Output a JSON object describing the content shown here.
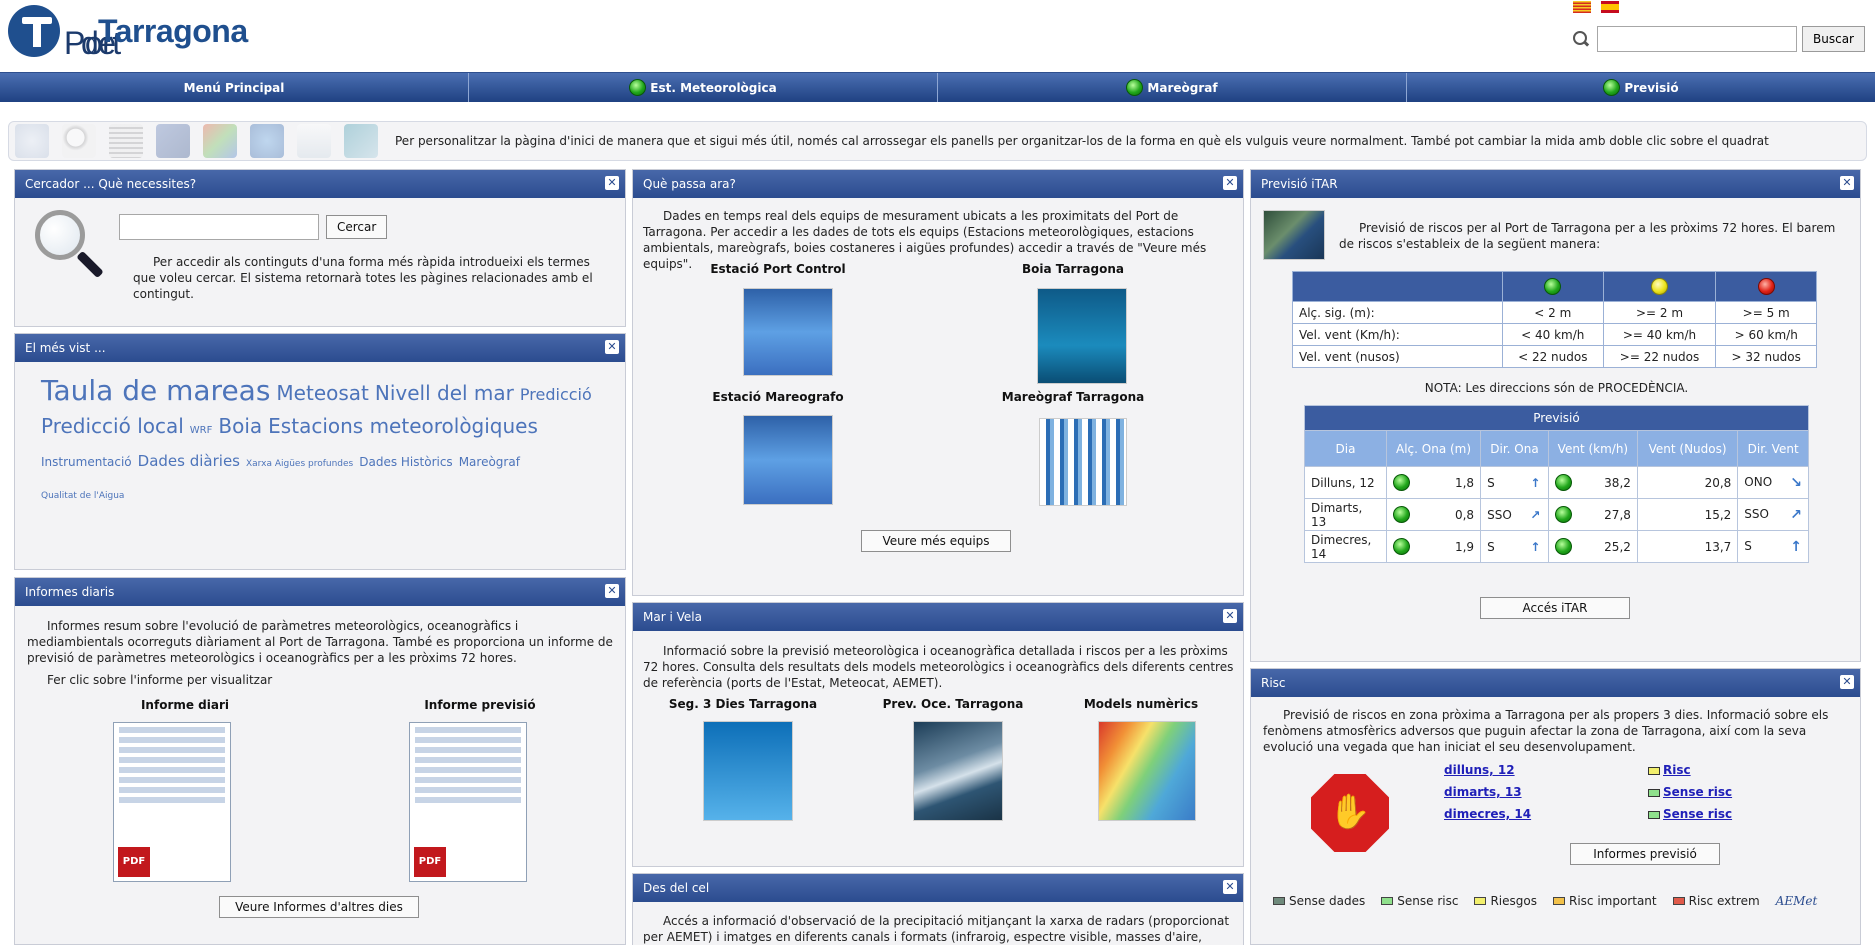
{
  "header": {
    "logo_light": "Port ",
    "logo_mid": "de ",
    "logo_bold": "Tarragona",
    "search_button": "Buscar"
  },
  "nav": [
    {
      "label": "Menú Principal",
      "light": false
    },
    {
      "label": "Est. Meteorològica",
      "light": true
    },
    {
      "label": "Mareògraf",
      "light": true
    },
    {
      "label": "Previsió",
      "light": true
    }
  ],
  "strip": {
    "text": "Per personalitzar la pàgina d'inici de manera que et sigui més útil, només cal arrossegar els panells per organitzar-los de la forma en què els vulguis veure normalment. També pot cambiar la mida amb doble clic sobre el quadrat"
  },
  "cercador": {
    "title": "Cercador ... Què necessites?",
    "button": "Cercar",
    "text": "Per accedir als continguts d'una forma més ràpida introdueixi els termes que voleu cercar. El sistema retornarà totes les pàgines relacionades amb el contingut."
  },
  "mesvist": {
    "title": "El més vist ...",
    "tags": [
      {
        "text": "Taula de mareas",
        "size": 28
      },
      {
        "text": "Meteosat",
        "size": 20
      },
      {
        "text": "Nivell del mar",
        "size": 20
      },
      {
        "text": "Predicció",
        "size": 16
      },
      {
        "text": "Predicció local",
        "size": 20
      },
      {
        "text": "WRF",
        "size": 10
      },
      {
        "text": "Boia",
        "size": 20
      },
      {
        "text": "Estacions meteorològiques",
        "size": 20
      },
      {
        "text": "Instrumentació",
        "size": 12
      },
      {
        "text": "Dades diàries",
        "size": 15
      },
      {
        "text": "Xarxa Aigües profundes",
        "size": 9
      },
      {
        "text": "Dades Històrics",
        "size": 12
      },
      {
        "text": "Mareògraf",
        "size": 12
      },
      {
        "text": "Qualitat de l'Aigua",
        "size": 9
      }
    ]
  },
  "informes": {
    "title": "Informes diaris",
    "text": "Informes resum sobre l'evolució de paràmetres meteorològics, oceanogràfics i mediambientals ocorreguts diàriament al Port de Tarragona. També es proporciona un informe de previsió de paràmetres meteorològics i oceanogràfics per a les pròxims 72 hores.",
    "click": "Fer clic sobre l'informe per visualitzar",
    "items": [
      "Informe diari",
      "Informe previsió"
    ],
    "button": "Veure Informes d'altres dies"
  },
  "quepassa": {
    "title": "Què passa ara?",
    "text": "Dades en temps real dels equips de mesurament ubicats a les proximitats del Port de Tarragona. Per accedir a les dades de tots els equips (Estacions meteorològiques, estacions ambientals, mareògrafs, boies costaneres i aigües profundes) accedir a través de \"Veure més equips\".",
    "items": [
      "Estació Port Control",
      "Boia Tarragona",
      "Estació Mareografo",
      "Mareògraf Tarragona"
    ],
    "button": "Veure més equips"
  },
  "marvela": {
    "title": "Mar i Vela",
    "text": "Informació sobre la previsió meteorològica i oceanogràfica detallada i riscos per a les pròxims 72 hores. Consulta dels resultats dels models meteorològics i oceanogràfics dels diferents centres de referència (ports de l'Estat, Meteocat, AEMET).",
    "items": [
      "Seg. 3 Dies Tarragona",
      "Prev. Oce. Tarragona",
      "Models numèrics"
    ]
  },
  "descel": {
    "title": "Des del cel",
    "text": "Accés a informació d'observació de la precipitació mitjançant la xarxa de radars (proporcionat per AEMET) i imatges en diferents canals i formats (infraroig, espectre visible, masses d'aire, vapor d'aigua) del"
  },
  "itar": {
    "title": "Previsió iTAR",
    "text": "Previsió de riscos per al Port de Tarragona per a les pròxims 72 hores. El barem de riscos s'estableix de la següent manera:",
    "risk_rows": [
      {
        "label": "Alç. sig. (m):",
        "g": "< 2 m",
        "y": ">= 2 m",
        "r": ">= 5 m"
      },
      {
        "label": "Vel. vent (Km/h):",
        "g": "< 40 km/h",
        "y": ">= 40 km/h",
        "r": "> 60 km/h"
      },
      {
        "label": "Vel. vent (nusos)",
        "g": "< 22 nudos",
        "y": ">= 22 nudos",
        "r": "> 32 nudos"
      }
    ],
    "note": "NOTA: Les direccions són de PROCEDÈNCIA.",
    "forecast_title": "Previsió",
    "forecast_headers": [
      "Dia",
      "Alç. Ona (m)",
      "Dir. Ona",
      "Vent (km/h)",
      "Vent (Nudos)",
      "Dir. Vent"
    ],
    "forecast_rows": [
      {
        "dia": "Dilluns, 12",
        "ona": "1,8",
        "dir_ona": "S",
        "arrow_ona": "↑",
        "vent": "38,2",
        "nudos": "20,8",
        "dir_vent": "ONO",
        "arrow_vent": "↘"
      },
      {
        "dia": "Dimarts, 13",
        "ona": "0,8",
        "dir_ona": "SSO",
        "arrow_ona": "↗",
        "vent": "27,8",
        "nudos": "15,2",
        "dir_vent": "SSO",
        "arrow_vent": "↗"
      },
      {
        "dia": "Dimecres, 14",
        "ona": "1,9",
        "dir_ona": "S",
        "arrow_ona": "↑",
        "vent": "25,2",
        "nudos": "13,7",
        "dir_vent": "S",
        "arrow_vent": "↑"
      }
    ],
    "button": "Accés iTAR"
  },
  "risc": {
    "title": "Risc",
    "text": "Previsió de riscos en zona pròxima a Tarragona per als propers 3 dies. Informació sobre els fenòmens atmosfèrics adversos que puguin afectar la zona de Tarragona, així com la seva evolució una vegada que han iniciat el seu desenvolupament.",
    "days": [
      {
        "day": "dilluns, 12",
        "status": "Risc",
        "color": "#f2ef6c"
      },
      {
        "day": "dimarts, 13",
        "status": "Sense risc",
        "color": "#8fe08c"
      },
      {
        "day": "dimecres, 14",
        "status": "Sense risc",
        "color": "#8fe08c"
      }
    ],
    "button": "Informes previsió",
    "legend": [
      {
        "label": "Sense dades",
        "color": "#6f8a7c"
      },
      {
        "label": "Sense risc",
        "color": "#8fe08c"
      },
      {
        "label": "Riesgos",
        "color": "#f2ef6c"
      },
      {
        "label": "Risc important",
        "color": "#f2c14a"
      },
      {
        "label": "Risc extrem",
        "color": "#e05a4a"
      }
    ],
    "aemet": "AEMet"
  }
}
